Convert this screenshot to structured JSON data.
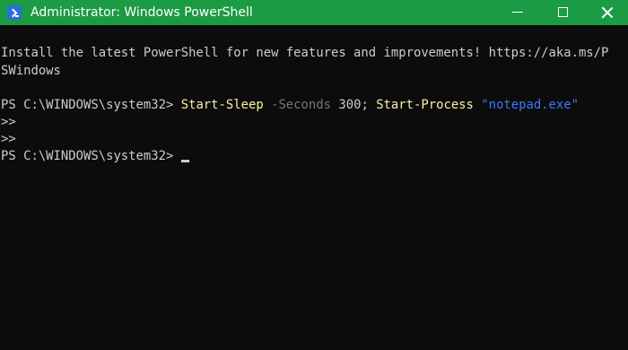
{
  "window": {
    "title": "Administrator: Windows PowerShell",
    "titlebar_color": "#1b9b43"
  },
  "icons": {
    "app": "powershell-icon",
    "minimize": "minimize-icon",
    "maximize": "maximize-icon",
    "close": "close-icon"
  },
  "console": {
    "background": "#0c0c0c",
    "banner_line1": "Install the latest PowerShell for new features and improvements! https://aka.ms/P",
    "banner_line2": "SWindows",
    "command_line": {
      "prompt": "PS C:\\WINDOWS\\system32> ",
      "cmd1": "Start-Sleep",
      "param1": " -Seconds",
      "value1": " 300; ",
      "cmd2": "Start-Process",
      "space": " ",
      "arg2": "\"notepad.exe\""
    },
    "continuation1": ">>",
    "continuation2": ">>",
    "final_prompt": "PS C:\\WINDOWS\\system32> "
  }
}
